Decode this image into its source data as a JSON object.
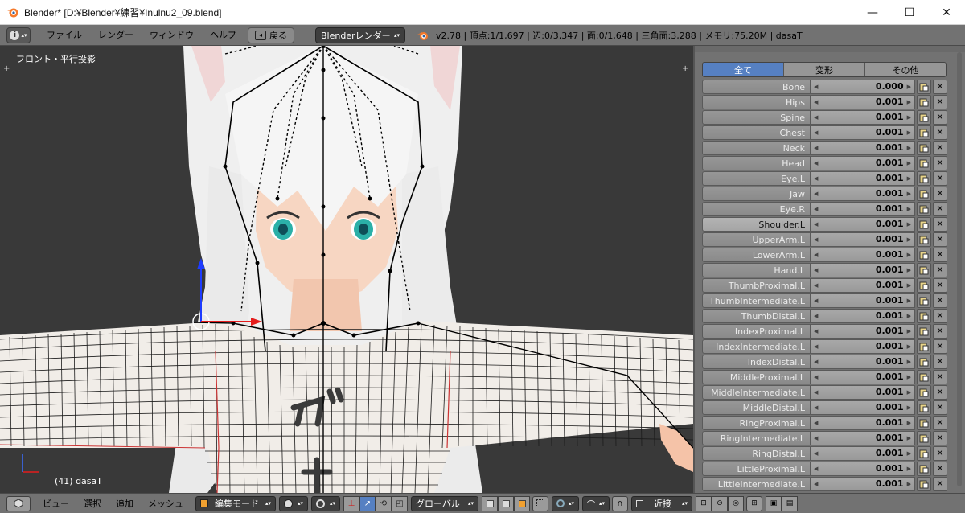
{
  "window": {
    "title": "Blender* [D:¥Blender¥練習¥Inulnu2_09.blend]",
    "minimize": "—",
    "maximize": "☐",
    "close": "✕"
  },
  "info_header": {
    "editor_icon": "i",
    "menus": [
      "ファイル",
      "レンダー",
      "ウィンドウ",
      "ヘルプ"
    ],
    "back_label": "戻る",
    "render_engine": "Blenderレンダー",
    "stats": "v2.78 | 頂点:1/1,697 | 辺:0/3,347 | 面:0/1,648 | 三角面:3,288 | メモリ:75.20M | dasaT"
  },
  "viewport": {
    "view_title": "フロント・平行投影",
    "status": "(41) dasaT"
  },
  "panel": {
    "tabs": [
      {
        "label": "全て",
        "active": true
      },
      {
        "label": "変形",
        "active": false
      },
      {
        "label": "その他",
        "active": false
      }
    ],
    "bones": [
      {
        "name": "Bone",
        "value": "0.000",
        "active": false
      },
      {
        "name": "Hips",
        "value": "0.001",
        "active": false
      },
      {
        "name": "Spine",
        "value": "0.001",
        "active": false
      },
      {
        "name": "Chest",
        "value": "0.001",
        "active": false
      },
      {
        "name": "Neck",
        "value": "0.001",
        "active": false
      },
      {
        "name": "Head",
        "value": "0.001",
        "active": false
      },
      {
        "name": "Eye.L",
        "value": "0.001",
        "active": false
      },
      {
        "name": "Jaw",
        "value": "0.001",
        "active": false
      },
      {
        "name": "Eye.R",
        "value": "0.001",
        "active": false
      },
      {
        "name": "Shoulder.L",
        "value": "0.001",
        "active": true
      },
      {
        "name": "UpperArm.L",
        "value": "0.001",
        "active": false
      },
      {
        "name": "LowerArm.L",
        "value": "0.001",
        "active": false
      },
      {
        "name": "Hand.L",
        "value": "0.001",
        "active": false
      },
      {
        "name": "ThumbProximal.L",
        "value": "0.001",
        "active": false
      },
      {
        "name": "ThumbIntermediate.L",
        "value": "0.001",
        "active": false
      },
      {
        "name": "ThumbDistal.L",
        "value": "0.001",
        "active": false
      },
      {
        "name": "IndexProximal.L",
        "value": "0.001",
        "active": false
      },
      {
        "name": "IndexIntermediate.L",
        "value": "0.001",
        "active": false
      },
      {
        "name": "IndexDistal.L",
        "value": "0.001",
        "active": false
      },
      {
        "name": "MiddleProximal.L",
        "value": "0.001",
        "active": false
      },
      {
        "name": "MiddleIntermediate.L",
        "value": "0.001",
        "active": false
      },
      {
        "name": "MiddleDistal.L",
        "value": "0.001",
        "active": false
      },
      {
        "name": "RingProximal.L",
        "value": "0.001",
        "active": false
      },
      {
        "name": "RingIntermediate.L",
        "value": "0.001",
        "active": false
      },
      {
        "name": "RingDistal.L",
        "value": "0.001",
        "active": false
      },
      {
        "name": "LittleProximal.L",
        "value": "0.001",
        "active": false
      },
      {
        "name": "LittleIntermediate.L",
        "value": "0.001",
        "active": false
      }
    ]
  },
  "bottom_header": {
    "menus": [
      "ビュー",
      "選択",
      "追加",
      "メッシュ"
    ],
    "mode": "編集モード",
    "orientation": "グローバル",
    "falloff": "近接"
  }
}
